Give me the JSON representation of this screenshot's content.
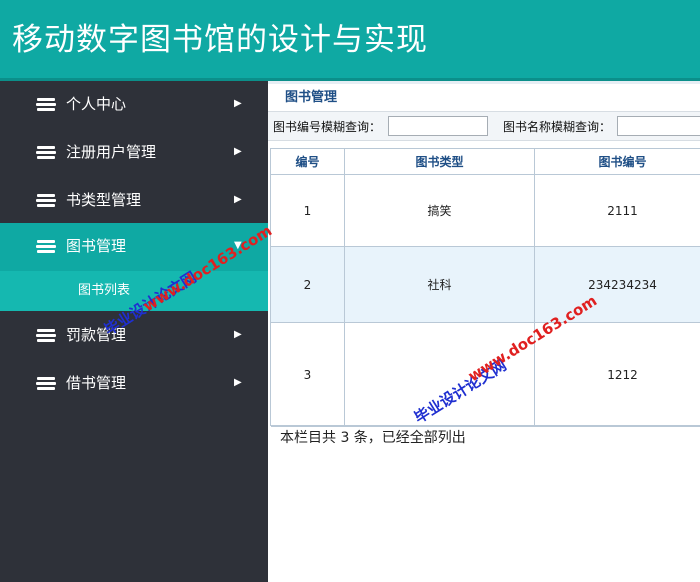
{
  "app": {
    "title": "移动数字图书馆的设计与实现"
  },
  "sidebar": {
    "items": [
      {
        "label": "个人中心",
        "arrow": "▶"
      },
      {
        "label": "注册用户管理",
        "arrow": "▶"
      },
      {
        "label": "书类型管理",
        "arrow": "▶"
      },
      {
        "label": "图书管理",
        "arrow": "▼"
      },
      {
        "label": "罚款管理",
        "arrow": "▶"
      },
      {
        "label": "借书管理",
        "arrow": "▶"
      }
    ],
    "sub_items": [
      {
        "label": "图书列表"
      }
    ],
    "active_item": "图书管理",
    "colors": {
      "background": "#2e3139",
      "active": "#0fa9a3",
      "sub_active": "#15b8b0"
    }
  },
  "main": {
    "panel_title": "图书管理",
    "search": {
      "book_no_label": "图书编号模糊查询：",
      "book_no_value": "",
      "book_name_label": "图书名称模糊查询：",
      "book_name_value": ""
    },
    "table": {
      "headers": [
        "编号",
        "图书类型",
        "图书编号"
      ],
      "rows": [
        [
          "1",
          "搞笑",
          "2111"
        ],
        [
          "2",
          "社科",
          "234234234"
        ],
        [
          "3",
          "",
          "1212"
        ]
      ]
    },
    "summary": "本栏目共 3 条，已经全部列出"
  },
  "watermark": {
    "url": "www.doc163.com",
    "text": "毕业设计论文网",
    "colors": {
      "url": "#e02020",
      "text": "#1f2fd0"
    }
  },
  "colors": {
    "header": "#0fa9a3",
    "title_text": "#1f4f86"
  }
}
